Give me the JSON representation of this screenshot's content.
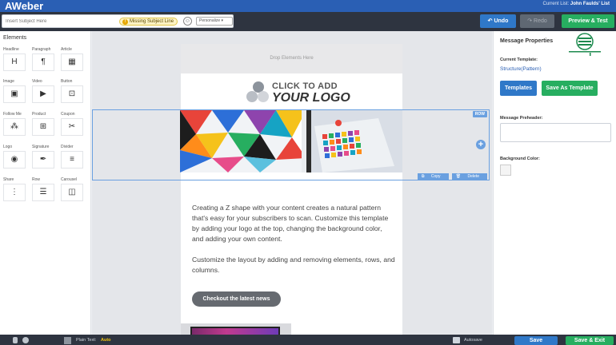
{
  "header": {
    "app_logo": "AWeber",
    "current_list_label": "Current List:",
    "current_list_value": "John Faulds' List"
  },
  "toolbar": {
    "subject_placeholder": "Insert Subject Here",
    "missing_subject_label": "Missing Subject Line",
    "personalize_label": "Personalize",
    "undo_label": "Undo",
    "redo_label": "Redo",
    "test_label": "Preview & Test"
  },
  "elements_panel": {
    "title": "Elements",
    "items": [
      {
        "label": "Headline",
        "icon": "heading-icon",
        "glyph": "H"
      },
      {
        "label": "Paragraph",
        "icon": "paragraph-icon",
        "glyph": "¶"
      },
      {
        "label": "Article",
        "icon": "article-icon",
        "glyph": "▦"
      },
      {
        "label": "Image",
        "icon": "image-icon",
        "glyph": "▣"
      },
      {
        "label": "Video",
        "icon": "video-icon",
        "glyph": "▶"
      },
      {
        "label": "Button",
        "icon": "button-icon",
        "glyph": "⊡"
      },
      {
        "label": "Follow Me",
        "icon": "follow-me-icon",
        "glyph": "⁂"
      },
      {
        "label": "Product",
        "icon": "product-icon",
        "glyph": "⊞"
      },
      {
        "label": "Coupon",
        "icon": "coupon-icon",
        "glyph": "✂"
      },
      {
        "label": "Logo",
        "icon": "logo-icon",
        "glyph": "◉"
      },
      {
        "label": "Signature",
        "icon": "signature-icon",
        "glyph": "✒"
      },
      {
        "label": "Divider",
        "icon": "divider-icon",
        "glyph": "≡"
      },
      {
        "label": "Share",
        "icon": "share-icon",
        "glyph": "⋮"
      },
      {
        "label": "Row",
        "icon": "row-icon",
        "glyph": "☰"
      },
      {
        "label": "Carousel",
        "icon": "carousel-icon",
        "glyph": "◫"
      }
    ]
  },
  "canvas": {
    "drop_here": "Drop Elements Here",
    "logo_line1": "CLICK TO ADD",
    "logo_line2": "YOUR LOGO",
    "row_badge": "ROW",
    "row_copy": "Copy",
    "row_delete": "Delete",
    "paragraph1": "Creating a Z shape with your content creates a natural pattern that's easy for your subscribers to scan. Customize this template by adding your logo at the top, changing the background color, and adding your own content.",
    "paragraph2": "Customize the layout by adding and removing elements, rows, and columns.",
    "cta_label": "Checkout the latest news"
  },
  "properties": {
    "title": "Message Properties",
    "current_template_label": "Current Template:",
    "current_template_value": "Structure(Pattern)",
    "templates_button": "Templates",
    "save_template_button": "Save As Template",
    "preheader_label": "Message Preheader:",
    "background_label": "Background Color:"
  },
  "footer": {
    "plain_text_label": "Plain Text:",
    "plain_text_mode": "Auto",
    "autosave_label": "Autosave",
    "save_label": "Save",
    "save_exit_label": "Save & Exit"
  },
  "colors": {
    "brand_blue": "#2a5fb4",
    "accent_blue": "#2f78c8",
    "accent_green": "#27ae60",
    "row_highlight": "#6aa0e0"
  }
}
